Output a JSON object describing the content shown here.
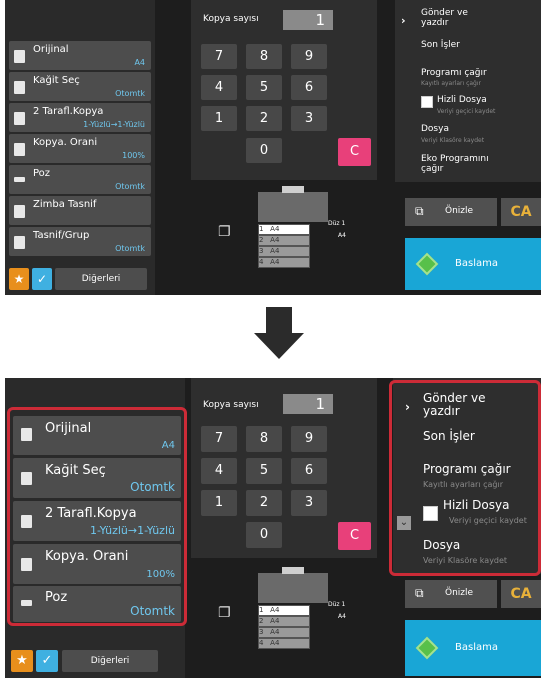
{
  "copy_count": {
    "label": "Kopya sayısı",
    "value": "1"
  },
  "keypad": {
    "keys": [
      "7",
      "8",
      "9",
      "4",
      "5",
      "6",
      "1",
      "2",
      "3",
      "0"
    ],
    "clear": "C"
  },
  "settings_top": [
    {
      "title": "Orijinal",
      "value": "A4"
    },
    {
      "title": "Kağit Seç",
      "value": "Otomtk"
    },
    {
      "title": "2 Tarafl.Kopya",
      "value": "1-Yüzlü→1-Yüzlü"
    },
    {
      "title": "Kopya. Orani",
      "value": "100%"
    },
    {
      "title": "Poz",
      "value": "Otomtk"
    },
    {
      "title": "Zimba Tasnif",
      "value": ""
    },
    {
      "title": "Tasnif/Grup",
      "value": "Otomtk"
    }
  ],
  "settings_bottom": [
    {
      "title": "Orijinal",
      "value": "A4"
    },
    {
      "title": "Kağit Seç",
      "value": "Otomtk"
    },
    {
      "title": "2 Tarafl.Kopya",
      "value": "1-Yüzlü→1-Yüzlü"
    },
    {
      "title": "Kopya. Orani",
      "value": "100%"
    },
    {
      "title": "Poz",
      "value": "Otomtk"
    }
  ],
  "right_menu": {
    "send_print": "Gönder ve yazdır",
    "recent_jobs": "Son İşler",
    "call_program": "Programı çağır",
    "call_program_sub": "Kayıtlı ayarları çağır",
    "quick_file": "Hizli Dosya",
    "quick_file_sub": "Veriyi geçici kaydet",
    "file": "Dosya",
    "file_sub": "Veriyi Klasöre kaydet",
    "eco": "Eko Programını çağır"
  },
  "preview_label": "Önizle",
  "ca_label": "CA",
  "start_label": "Baslama",
  "others_label": "Diğerleri",
  "machine": {
    "output_tray": "Düz 1",
    "output_size": "A4",
    "trays": [
      {
        "num": "1",
        "size": "A4"
      },
      {
        "num": "2",
        "size": "A4"
      },
      {
        "num": "3",
        "size": "A4"
      },
      {
        "num": "4",
        "size": "A4"
      }
    ]
  },
  "colors": {
    "accent_blue": "#19a6d6",
    "clear_pink": "#e8407a",
    "ca_orange": "#e8b13a",
    "highlight_red": "#cc2b37"
  }
}
